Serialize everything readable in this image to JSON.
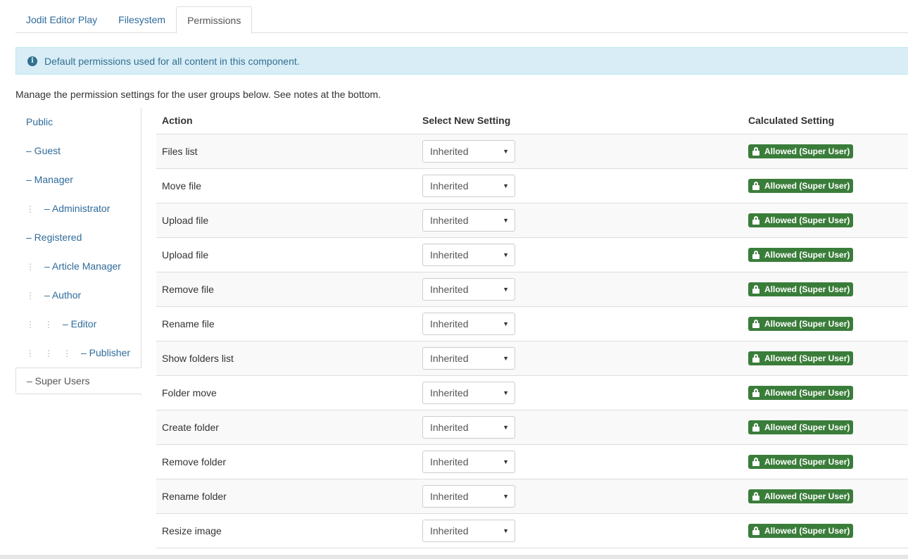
{
  "tabs": [
    {
      "label": "Jodit Editor Play"
    },
    {
      "label": "Filesystem"
    },
    {
      "label": "Permissions"
    }
  ],
  "alert": {
    "icon": "info-icon",
    "text": "Default permissions used for all content in this component."
  },
  "intro": "Manage the permission settings for the user groups below. See notes at the bottom.",
  "groups": [
    {
      "label": "Public",
      "level": 0
    },
    {
      "label": "– Guest",
      "level": 0
    },
    {
      "label": "– Manager",
      "level": 0
    },
    {
      "label": "– Administrator",
      "level": 1
    },
    {
      "label": "– Registered",
      "level": 0
    },
    {
      "label": "– Article Manager",
      "level": 1
    },
    {
      "label": "– Author",
      "level": 1
    },
    {
      "label": "– Editor",
      "level": 2
    },
    {
      "label": "– Publisher",
      "level": 3
    },
    {
      "label": "– Super Users",
      "level": 0,
      "active": true
    }
  ],
  "table": {
    "headers": {
      "action": "Action",
      "select": "Select New Setting",
      "calculated": "Calculated Setting"
    },
    "rows": [
      {
        "action": "Files list",
        "setting": "Inherited",
        "calculated": "Allowed (Super User)"
      },
      {
        "action": "Move file",
        "setting": "Inherited",
        "calculated": "Allowed (Super User)"
      },
      {
        "action": "Upload file",
        "setting": "Inherited",
        "calculated": "Allowed (Super User)"
      },
      {
        "action": "Upload file",
        "setting": "Inherited",
        "calculated": "Allowed (Super User)"
      },
      {
        "action": "Remove file",
        "setting": "Inherited",
        "calculated": "Allowed (Super User)"
      },
      {
        "action": "Rename file",
        "setting": "Inherited",
        "calculated": "Allowed (Super User)"
      },
      {
        "action": "Show folders list",
        "setting": "Inherited",
        "calculated": "Allowed (Super User)"
      },
      {
        "action": "Folder move",
        "setting": "Inherited",
        "calculated": "Allowed (Super User)"
      },
      {
        "action": "Create folder",
        "setting": "Inherited",
        "calculated": "Allowed (Super User)"
      },
      {
        "action": "Remove folder",
        "setting": "Inherited",
        "calculated": "Allowed (Super User)"
      },
      {
        "action": "Rename folder",
        "setting": "Inherited",
        "calculated": "Allowed (Super User)"
      },
      {
        "action": "Resize image",
        "setting": "Inherited",
        "calculated": "Allowed (Super User)"
      }
    ]
  },
  "colors": {
    "link": "#2f6b9a",
    "alert_bg": "#d9edf7",
    "alert_text": "#31708f",
    "badge_success": "#3a7d3a"
  }
}
